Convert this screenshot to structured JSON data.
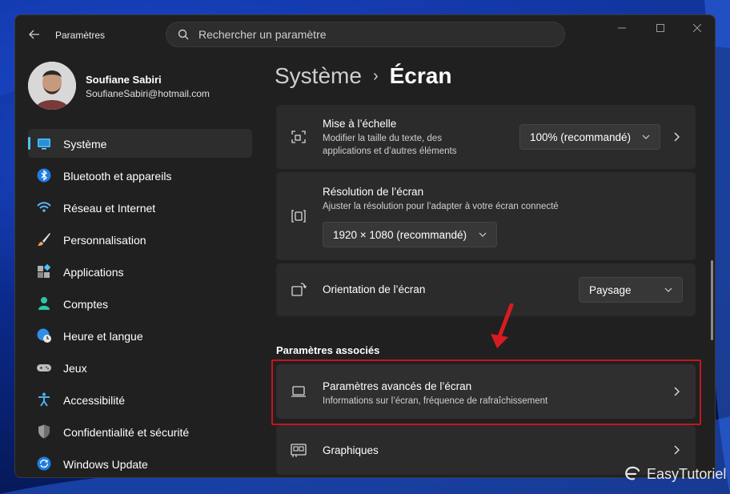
{
  "window": {
    "title": "Paramètres"
  },
  "search": {
    "placeholder": "Rechercher un paramètre"
  },
  "user": {
    "name": "Soufiane Sabiri",
    "email": "SoufianeSabiri@hotmail.com"
  },
  "sidebar": {
    "items": [
      {
        "label": "Système",
        "icon": "display-icon",
        "active": true
      },
      {
        "label": "Bluetooth et appareils",
        "icon": "bluetooth-icon"
      },
      {
        "label": "Réseau et Internet",
        "icon": "wifi-icon"
      },
      {
        "label": "Personnalisation",
        "icon": "paintbrush-icon"
      },
      {
        "label": "Applications",
        "icon": "apps-icon"
      },
      {
        "label": "Comptes",
        "icon": "person-icon"
      },
      {
        "label": "Heure et langue",
        "icon": "globe-clock-icon"
      },
      {
        "label": "Jeux",
        "icon": "gamepad-icon"
      },
      {
        "label": "Accessibilité",
        "icon": "accessibility-icon"
      },
      {
        "label": "Confidentialité et sécurité",
        "icon": "shield-icon"
      },
      {
        "label": "Windows Update",
        "icon": "update-icon"
      }
    ]
  },
  "breadcrumb": {
    "parent": "Système",
    "separator": "›",
    "current": "Écran"
  },
  "cards": {
    "scale": {
      "title": "Mise à l’échelle",
      "subtitle_line1": "Modifier la taille du texte, des",
      "subtitle_line2": "applications et d’autres éléments",
      "value": "100% (recommandé)"
    },
    "resolution": {
      "title": "Résolution de l’écran",
      "subtitle": "Ajuster la résolution pour l’adapter à  votre  écran connecté",
      "value": "1920 × 1080 (recommandé)"
    },
    "orientation": {
      "title": "Orientation de l’écran",
      "value": "Paysage"
    }
  },
  "related": {
    "section_title": "Paramètres associés",
    "advanced": {
      "title": "Paramètres avancés de l’écran",
      "subtitle": "Informations sur l’écran, fréquence de rafraîchissement"
    },
    "graphics": {
      "title": "Graphiques"
    }
  },
  "watermark": {
    "text": "EasyTutoriel"
  },
  "colors": {
    "accent": "#4cc2ff",
    "highlight": "#c4161c",
    "window_bg": "#202020",
    "card_bg": "#2b2b2b"
  }
}
